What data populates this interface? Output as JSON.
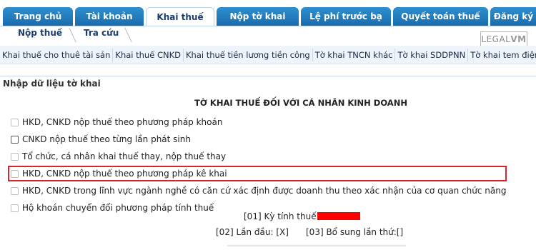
{
  "tabs": [
    "Trang chủ",
    "Tài khoản",
    "Khai thuế",
    "Nộp tờ khai",
    "Lệ phí trước bạ",
    "Quyết toán thuế",
    "Đăng ký thuế"
  ],
  "active_tab": "Khai thuế",
  "subtabs": [
    "Nộp thuế",
    "Tra cứu"
  ],
  "logo": {
    "prefix": "LEGAL",
    "suffix": "VM"
  },
  "categories": [
    "Khai thuế cho thuê tài sản",
    "Khai thuế CNKD",
    "Khai thuế tiền lương tiền công",
    "Tờ khai TNCN khác",
    "Tờ khai SDDPNN",
    "Tờ khai tem điện tử"
  ],
  "section_title": "Nhập dữ liệu tờ khai",
  "form_title": "TỜ KHAI THUẾ ĐỐI VỚI CÁ NHÂN KINH DOANH",
  "options": [
    "HKD, CNKD nộp thuế theo phương pháp khoán",
    "CNKD nộp thuế theo từng lần phát sinh",
    "Tổ chức, cá nhân khai thuế thay, nộp thuế thay",
    "HKD, CNKD nộp thuế theo phương pháp kê khai",
    "HKD, CNKD trong lĩnh vực ngành nghề có căn cứ xác định được doanh thu theo xác nhận của cơ quan chức năng",
    "Hộ khoán chuyển đổi phương pháp tính thuế"
  ],
  "highlighted_option": "HKD, CNKD nộp thuế theo phương pháp kê khai",
  "fields": {
    "period_label": "[01] Kỳ tính thuế:",
    "first_time_label": "[02] Lần đầu: [X]",
    "supplement_label": "[03] Bổ sung lần thứ:[]"
  },
  "colors": {
    "tab_blue": "#1f78bd",
    "highlight_red": "#d9242b",
    "redaction": "#ff0000"
  }
}
